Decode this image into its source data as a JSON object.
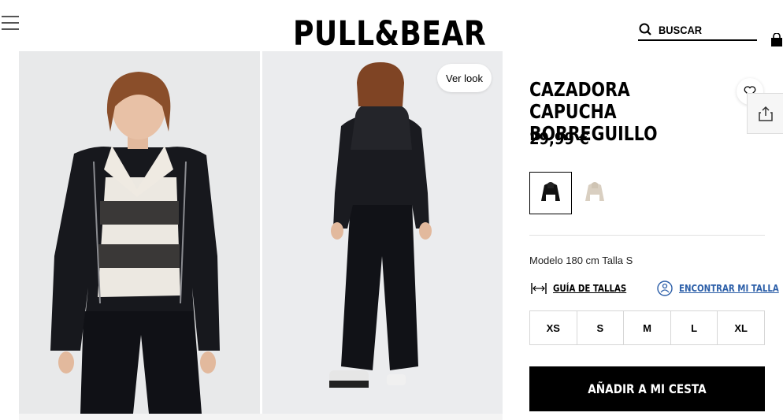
{
  "header": {
    "brand": "PULL&BEAR",
    "search_label": "BUSCAR"
  },
  "gallery": {
    "ver_look_label": "Ver look"
  },
  "product": {
    "title": "CAZADORA CAPUCHA BORREGUILLO",
    "price": "29,99 €",
    "colors": [
      {
        "name": "black",
        "hex": "#111111",
        "selected": true
      },
      {
        "name": "beige",
        "hex": "#d9cfc1",
        "selected": false
      }
    ],
    "model_info": "Modelo 180 cm Talla S",
    "size_guide_label": "GUÍA DE TALLAS",
    "find_size_label": "ENCONTRAR MI TALLA",
    "sizes": [
      "XS",
      "S",
      "M",
      "L",
      "XL"
    ],
    "add_to_cart_label": "AÑADIR A MI CESTA"
  },
  "colors": {
    "link_blue": "#2b5ea8",
    "button_black": "#000000"
  },
  "icons": [
    "menu-icon",
    "search-icon",
    "shopping-bag-icon",
    "heart-icon",
    "share-icon",
    "ruler-icon",
    "person-size-icon"
  ]
}
